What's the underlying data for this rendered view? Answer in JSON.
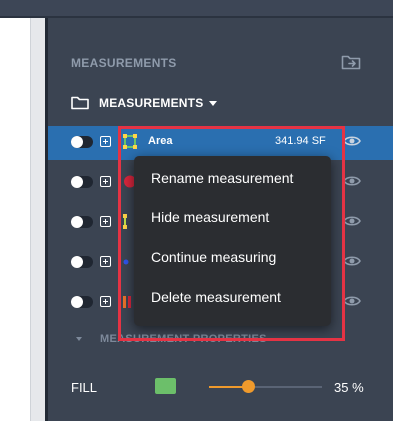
{
  "colors": {
    "panel": "#3b4452",
    "selected_row": "#2a6fb0",
    "menu_bg": "#2b2d31",
    "highlight_border": "#e53344",
    "slider_accent": "#ef9a2c",
    "fill_swatch": "#6cbf6a"
  },
  "panel": {
    "section_header": "MEASUREMENTS",
    "add_folder_icon": "add-folder-icon",
    "folder": {
      "label": "MEASUREMENTS",
      "icon": "folder-icon"
    }
  },
  "measurements": [
    {
      "name": "Area",
      "value": "341.94 SF",
      "type_icon": "area-icon",
      "selected": true
    },
    {
      "name": "",
      "value": "",
      "type_icon": "count-icon",
      "selected": false
    },
    {
      "name": "",
      "value": "",
      "type_icon": "linear-icon",
      "selected": false
    },
    {
      "name": "",
      "value": "",
      "type_icon": "point-icon",
      "selected": false
    },
    {
      "name": "",
      "value": "",
      "type_icon": "segment-icon",
      "selected": false
    }
  ],
  "context_menu": {
    "items": [
      "Rename measurement",
      "Hide measurement",
      "Continue measuring",
      "Delete measurement"
    ]
  },
  "properties": {
    "header": "MEASUREMENT PROPERTIES",
    "fill_label": "FILL",
    "fill_opacity_percent": 35,
    "fill_opacity_label": "35 %"
  }
}
